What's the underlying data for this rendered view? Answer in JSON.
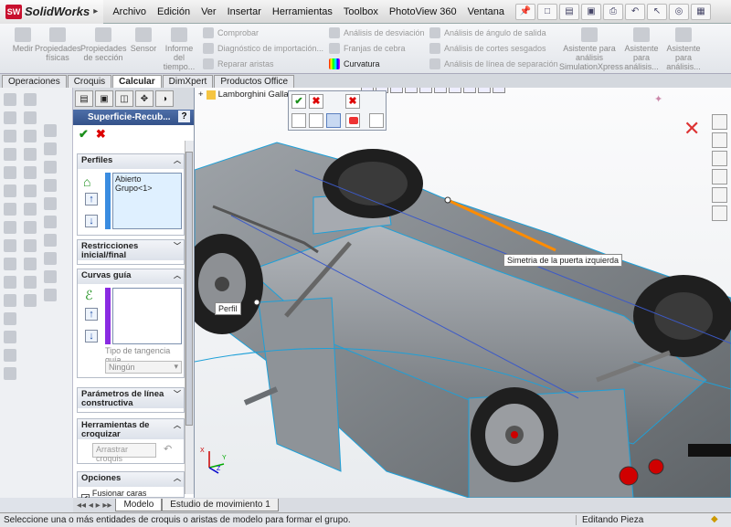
{
  "app": {
    "name": "SolidWorks",
    "logo_text": "SW"
  },
  "menu": [
    "Archivo",
    "Edición",
    "Ver",
    "Insertar",
    "Herramientas",
    "Toolbox",
    "PhotoView 360",
    "Ventana"
  ],
  "ribbon": {
    "buttons": [
      "Medir",
      "Propiedades físicas",
      "Propiedades de sección",
      "Sensor",
      "Informe del tiempo..."
    ],
    "col1": [
      "Comprobar",
      "Diagnóstico de importación...",
      "Reparar aristas"
    ],
    "col2": [
      "Análisis de desviación",
      "Franjas de cebra",
      "Curvatura"
    ],
    "col3": [
      "Análisis de ángulo de salida",
      "Análisis de cortes sesgados",
      "Análisis de línea de separación"
    ],
    "right": [
      "Asistente para análisis SimulationXpress",
      "Asistente para análisis...",
      "Asistente para análisis..."
    ]
  },
  "tabs": [
    "Operaciones",
    "Croquis",
    "Calcular",
    "DimXpert",
    "Productos Office"
  ],
  "active_tab": "Calcular",
  "tree_root": "Lamborghini Gallardo",
  "property_manager": {
    "title": "Superficie-Recub...",
    "help": "?",
    "perfiles_label": "Perfiles",
    "perfiles_item": "Abierto Grupo<1>",
    "restricciones_label": "Restricciones inicial/final",
    "curvas_label": "Curvas guía",
    "tangencia_label": "Tipo de tangencia guía",
    "tangencia_value": "Ningún",
    "parametros_label": "Parámetros de línea constructiva",
    "herramientas_label": "Herramientas de croquizar",
    "arrastrar_label": "Arrastrar croquis",
    "opciones_label": "Opciones",
    "fusionar_label": "Fusionar caras tangentes"
  },
  "viewport": {
    "tooltip_simetria": "Simetria de la puerta izquierda",
    "tooltip_perfil": "Perfil",
    "triad": [
      "X",
      "Y",
      "Z"
    ]
  },
  "bottom_tabs": [
    "Modelo",
    "Estudio de movimiento 1"
  ],
  "status": {
    "message": "Seleccione una o más entidades de croquis o aristas de modelo para formar el grupo.",
    "mode": "Editando Pieza"
  },
  "colors": {
    "title_blue": "#34528a",
    "highlight_orange": "#ff8c00",
    "edge_cyan": "#1ea0d8",
    "taillight_red": "#d00000"
  }
}
